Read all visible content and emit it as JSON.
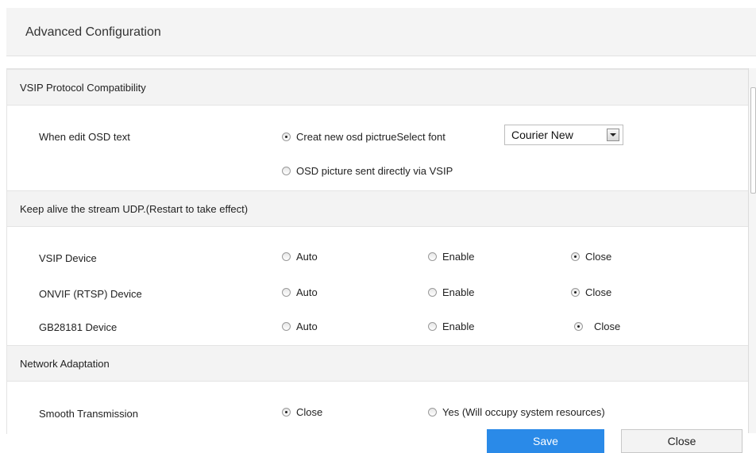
{
  "dialog": {
    "title": "Advanced Configuration"
  },
  "sections": {
    "vsip": {
      "title": "VSIP Protocol Compatibility",
      "osd_label": "When edit OSD text",
      "option_create": "Creat new osd pictrueSelect font",
      "option_direct": "OSD picture sent directly via VSIP",
      "font_value": "Courier New",
      "selected": "create"
    },
    "keepalive": {
      "title": "Keep alive the stream UDP.(Restart to take effect)",
      "options": {
        "auto": "Auto",
        "enable": "Enable",
        "close": "Close"
      },
      "rows": [
        {
          "label": "VSIP Device",
          "selected": "close"
        },
        {
          "label": "ONVIF (RTSP) Device",
          "selected": "close"
        },
        {
          "label": "GB28181 Device",
          "selected": "close"
        }
      ]
    },
    "network": {
      "title": "Network Adaptation",
      "smooth_label": "Smooth Transmission",
      "option_close": "Close",
      "option_yes": "Yes (Will occupy system resources)",
      "selected": "close"
    }
  },
  "buttons": {
    "save": "Save",
    "close": "Close"
  },
  "colors": {
    "primary": "#2a8ae8",
    "section_bg": "#f3f3f3"
  },
  "icons": {
    "select_arrow": "chevron-down-icon",
    "radio": "radio-icon"
  }
}
